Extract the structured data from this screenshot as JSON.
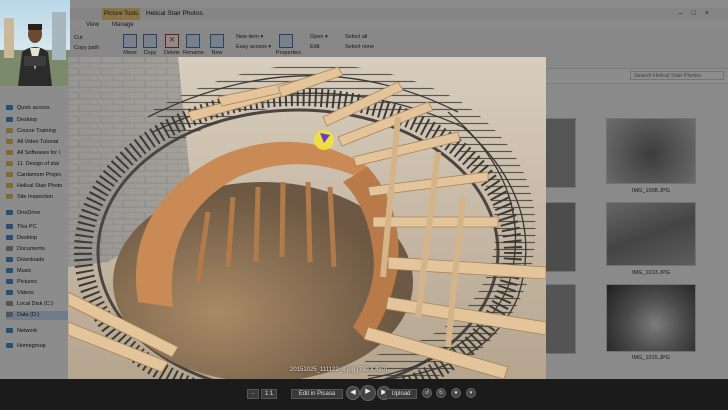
{
  "explorer": {
    "title": "Helical Stair Photos",
    "context_tab": "Picture Tools",
    "tabs": [
      "View",
      "Manage"
    ],
    "window_controls": [
      "–",
      "□",
      "×"
    ],
    "ribbon": {
      "cut": "Cut",
      "copy_path": "Copy path",
      "move": "Move",
      "copy": "Copy",
      "delete": "Delete",
      "rename": "Rename",
      "new_label": "New",
      "new_item": "New item ▾",
      "easy_access": "Easy access ▾",
      "properties": "Properties",
      "open": "Open ▾",
      "edit": "Edit",
      "select_all": "Select all",
      "select_none": "Select none"
    },
    "search_placeholder": "Search Helical Stair Photos",
    "nav": {
      "quick_access": "Quick access",
      "items": [
        "Desktop",
        "Course Training",
        "All Video Tutorial",
        "All Softwares for l",
        "11. Design of stai",
        "Cardamom Projec",
        "Helical Stair Photo",
        "Site Inspection"
      ],
      "onedrive": "OneDrive",
      "this_pc": "This PC",
      "pc_items": [
        "Desktop",
        "Documents",
        "Downloads",
        "Music",
        "Pictures",
        "Videos",
        "Local Disk (C:)",
        "Data (D:)"
      ],
      "network": "Network",
      "homegroup": "Homegroup"
    },
    "thumbs": [
      "IMG_1008.JPG",
      "IMG_1013.JPG",
      "IMG_1015.JPG"
    ]
  },
  "viewer": {
    "caption": "20151025_111122_8.jpg (799 x 450)",
    "zoom_label": "1:1",
    "edit_button": "Edit in Picasa",
    "upload_button": "Upload",
    "prev_icon": "◀",
    "play_icon": "▶",
    "next_icon": "▶",
    "minus_icon": "-",
    "plus_icon": "+"
  },
  "colors": {
    "accent": "#4a7bc4",
    "context_tab": "#f6d27a",
    "toolbar": "#1b1b1b",
    "formwork_wood": "#c98a55",
    "rebar": "#3c3a36"
  }
}
